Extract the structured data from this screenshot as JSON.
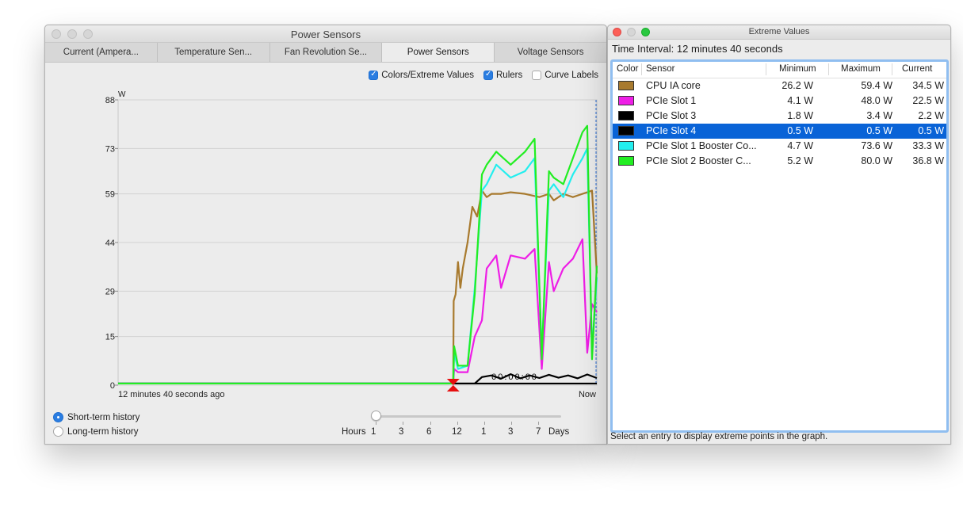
{
  "power_window": {
    "title": "Power Sensors",
    "tabs": [
      {
        "label": "Current (Ampera..."
      },
      {
        "label": "Temperature Sen..."
      },
      {
        "label": "Fan Revolution Se..."
      },
      {
        "label": "Power Sensors",
        "active": true
      },
      {
        "label": "Voltage Sensors"
      }
    ],
    "options": {
      "colors_extreme": {
        "label": "Colors/Extreme Values",
        "checked": true
      },
      "rulers": {
        "label": "Rulers",
        "checked": true
      },
      "curve_labels": {
        "label": "Curve Labels",
        "checked": false
      }
    },
    "history": {
      "short_term": {
        "label": "Short-term history",
        "selected": true
      },
      "long_term": {
        "label": "Long-term history",
        "selected": false
      }
    },
    "scale": {
      "hours_label": "Hours",
      "days_label": "Days",
      "ticks": [
        "1",
        "3",
        "6",
        "12",
        "1",
        "3",
        "7"
      ],
      "position": 0
    }
  },
  "chart_data": {
    "type": "line",
    "ylabel": "W",
    "yticks": [
      0,
      15,
      29,
      44,
      59,
      73,
      88
    ],
    "ylim": [
      0,
      88
    ],
    "x_start_label": "12 minutes 40 seconds ago",
    "x_end_label": "Now",
    "x_unit": "fraction of interval",
    "overlay_text": "00:00:00",
    "grid": true,
    "series": [
      {
        "name": "CPU IA core",
        "color": "#a87a2e",
        "x": [
          0.0,
          0.7,
          0.701,
          0.705,
          0.71,
          0.715,
          0.72,
          0.73,
          0.74,
          0.75,
          0.76,
          0.77,
          0.78,
          0.8,
          0.82,
          0.85,
          0.88,
          0.9,
          0.91,
          0.93,
          0.95,
          0.97,
          0.99,
          1.0
        ],
        "y": [
          0.5,
          0.5,
          26,
          28,
          38,
          30,
          36,
          44,
          55,
          52,
          60,
          58,
          59,
          59,
          59.5,
          59,
          58,
          59,
          57,
          59,
          58,
          59,
          60,
          34.5
        ]
      },
      {
        "name": "PCIe Slot 1",
        "color": "#ee1ee6",
        "x": [
          0.0,
          0.7,
          0.702,
          0.71,
          0.73,
          0.745,
          0.76,
          0.77,
          0.79,
          0.8,
          0.82,
          0.85,
          0.87,
          0.885,
          0.9,
          0.91,
          0.93,
          0.95,
          0.97,
          0.98,
          0.99,
          1.0
        ],
        "y": [
          0.5,
          0.5,
          5,
          4,
          4,
          15,
          20,
          36,
          40,
          30,
          40,
          39,
          42,
          5,
          38,
          29,
          36,
          39,
          45,
          10,
          25,
          22.5
        ]
      },
      {
        "name": "PCIe Slot 3",
        "color": "#000000",
        "x": [
          0.0,
          0.745,
          0.76,
          0.78,
          0.8,
          0.82,
          0.84,
          0.86,
          0.88,
          0.9,
          0.92,
          0.94,
          0.96,
          0.98,
          1.0
        ],
        "y": [
          0.5,
          0.5,
          2.5,
          3,
          2,
          3.4,
          2.1,
          3,
          2.2,
          3.2,
          2.3,
          3,
          2.1,
          3.3,
          2.2
        ]
      },
      {
        "name": "PCIe Slot 4",
        "color": "#000000",
        "x": [
          0.0,
          1.0
        ],
        "y": [
          0.5,
          0.5
        ]
      },
      {
        "name": "PCIe Slot 1 Booster Co...",
        "color": "#22eeee",
        "x": [
          0.0,
          0.7,
          0.702,
          0.71,
          0.73,
          0.745,
          0.76,
          0.77,
          0.79,
          0.82,
          0.85,
          0.87,
          0.885,
          0.9,
          0.91,
          0.93,
          0.95,
          0.97,
          0.98,
          0.99,
          1.0
        ],
        "y": [
          0.5,
          0.5,
          10,
          5,
          6,
          30,
          60,
          62,
          68,
          64,
          66,
          70,
          10,
          60,
          62,
          58,
          65,
          70,
          73,
          10,
          33.3
        ]
      },
      {
        "name": "PCIe Slot 2 Booster C...",
        "color": "#22ee22",
        "x": [
          0.0,
          0.7,
          0.702,
          0.71,
          0.73,
          0.745,
          0.76,
          0.77,
          0.79,
          0.82,
          0.85,
          0.87,
          0.885,
          0.9,
          0.91,
          0.93,
          0.95,
          0.97,
          0.98,
          0.99,
          1.0
        ],
        "y": [
          0.5,
          0.5,
          12,
          6,
          6,
          28,
          65,
          68,
          72,
          68,
          72,
          76,
          8,
          66,
          64,
          62,
          70,
          78,
          80,
          8,
          36.8
        ]
      }
    ]
  },
  "extreme_window": {
    "title": "Extreme Values",
    "time_interval": "Time Interval: 12 minutes 40 seconds",
    "columns": {
      "color": "Color",
      "sensor": "Sensor",
      "minimum": "Minimum",
      "maximum": "Maximum",
      "current": "Current"
    },
    "rows": [
      {
        "color": "#a87a2e",
        "sensor": "CPU IA core",
        "minimum": "26.2 W",
        "maximum": "59.4 W",
        "current": "34.5 W",
        "selected": false
      },
      {
        "color": "#ee1ee6",
        "sensor": "PCIe Slot 1",
        "minimum": "4.1 W",
        "maximum": "48.0 W",
        "current": "22.5 W",
        "selected": false
      },
      {
        "color": "#000000",
        "sensor": "PCIe Slot 3",
        "minimum": "1.8 W",
        "maximum": "3.4 W",
        "current": "2.2 W",
        "selected": false
      },
      {
        "color": "#000000",
        "sensor": "PCIe Slot 4",
        "minimum": "0.5 W",
        "maximum": "0.5 W",
        "current": "0.5 W",
        "selected": true
      },
      {
        "color": "#22eeee",
        "sensor": "PCIe Slot 1 Booster Co...",
        "minimum": "4.7 W",
        "maximum": "73.6 W",
        "current": "33.3 W",
        "selected": false
      },
      {
        "color": "#22ee22",
        "sensor": "PCIe Slot 2 Booster C...",
        "minimum": "5.2 W",
        "maximum": "80.0 W",
        "current": "36.8 W",
        "selected": false
      }
    ],
    "footer": "Select an entry to display extreme points in the graph."
  }
}
